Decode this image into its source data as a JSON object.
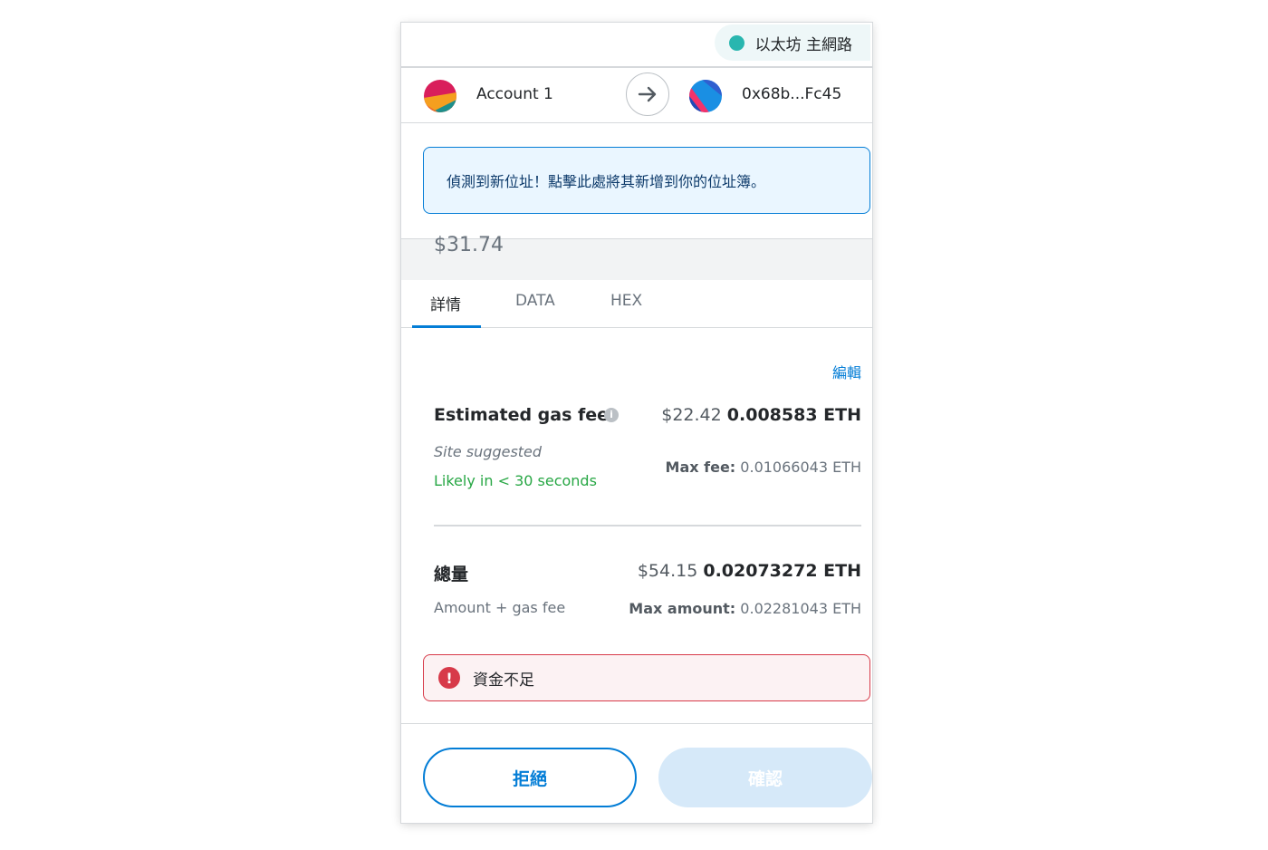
{
  "network": {
    "label": "以太坊 主網路",
    "dot_color": "#29b6af"
  },
  "accounts": {
    "from_name": "Account 1",
    "to_address": "0x68b...Fc45"
  },
  "notice": {
    "text": "偵測到新位址！點擊此處將其新增到你的位址簿。"
  },
  "fiat_total_partial": "$31.74",
  "tabs": [
    {
      "label": "詳情",
      "active": true
    },
    {
      "label": "DATA",
      "active": false
    },
    {
      "label": "HEX",
      "active": false
    }
  ],
  "details": {
    "edit_label": "編輯",
    "gas": {
      "title": "Estimated gas fee",
      "fiat": "$22.42",
      "eth": "0.008583 ETH",
      "site_suggested": "Site suggested",
      "likely": "Likely in < 30 seconds",
      "max_fee_label": "Max fee:",
      "max_fee_value": "0.01066043 ETH"
    },
    "total": {
      "title": "總量",
      "fiat": "$54.15",
      "eth": "0.02073272 ETH",
      "subtitle": "Amount + gas fee",
      "max_amount_label": "Max amount:",
      "max_amount_value": "0.02281043 ETH"
    }
  },
  "error": {
    "text": "資金不足"
  },
  "footer": {
    "reject_label": "拒絕",
    "confirm_label": "確認"
  },
  "colors": {
    "accent": "#037dd6",
    "error": "#d73a49",
    "success": "#28a745"
  }
}
